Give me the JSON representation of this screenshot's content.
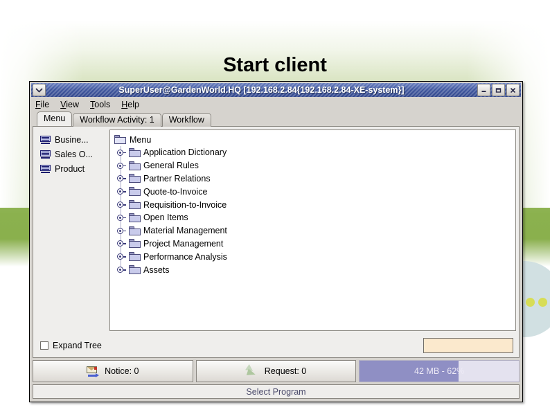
{
  "slide": {
    "title": "Start client"
  },
  "window": {
    "title": "SuperUser@GardenWorld.HQ [192.168.2.84{192.168.2.84-XE-system}]",
    "system_menu_icon": "chevron-down-icon",
    "controls": {
      "minimize": "–",
      "maximize": "❐",
      "close": "✖"
    }
  },
  "menubar": {
    "items": [
      {
        "label": "File",
        "mnemonic": "F",
        "rest": "ile"
      },
      {
        "label": "View",
        "mnemonic": "V",
        "rest": "iew"
      },
      {
        "label": "Tools",
        "mnemonic": "T",
        "rest": "ools"
      },
      {
        "label": "Help",
        "mnemonic": "H",
        "rest": "elp"
      }
    ]
  },
  "tabs": [
    {
      "label": "Menu",
      "active": true
    },
    {
      "label": "Workflow Activity: 1",
      "active": false
    },
    {
      "label": "Workflow",
      "active": false
    }
  ],
  "sidebar": {
    "items": [
      {
        "label": "Busine...",
        "icon": "screen-icon"
      },
      {
        "label": "Sales O...",
        "icon": "screen-icon"
      },
      {
        "label": "Product",
        "icon": "screen-icon"
      }
    ]
  },
  "tree": {
    "root": {
      "label": "Menu",
      "icon": "folder-icon"
    },
    "nodes": [
      {
        "label": "Application Dictionary",
        "icon": "folder-icon",
        "handle": "expand-handle"
      },
      {
        "label": "General Rules",
        "icon": "folder-icon",
        "handle": "expand-handle"
      },
      {
        "label": "Partner Relations",
        "icon": "folder-icon",
        "handle": "expand-handle"
      },
      {
        "label": "Quote-to-Invoice",
        "icon": "folder-icon",
        "handle": "expand-handle"
      },
      {
        "label": "Requisition-to-Invoice",
        "icon": "folder-icon",
        "handle": "expand-handle"
      },
      {
        "label": "Open Items",
        "icon": "folder-icon",
        "handle": "expand-handle"
      },
      {
        "label": "Material Management",
        "icon": "folder-icon",
        "handle": "expand-handle"
      },
      {
        "label": "Project Management",
        "icon": "folder-icon",
        "handle": "expand-handle"
      },
      {
        "label": "Performance Analysis",
        "icon": "folder-icon",
        "handle": "expand-handle"
      },
      {
        "label": "Assets",
        "icon": "folder-icon",
        "handle": "expand-handle"
      }
    ]
  },
  "footer": {
    "expand_tree_label": "Expand Tree",
    "expand_tree_checked": false,
    "search_value": "",
    "search_placeholder": ""
  },
  "statusbar": {
    "notice_label": "Notice: 0",
    "request_label": "Request: 0",
    "memory_label": "42 MB - 62%",
    "memory_percent": 62,
    "select_program_label": "Select Program"
  },
  "colors": {
    "slide_green": "#8bb14e",
    "titlebar_blue": "#41589f",
    "memory_fill": "#8f8fc4",
    "memory_track": "#e4e2ef",
    "search_field": "#fbe9cd",
    "folder": "#c9cbeb",
    "deco_dot": "#d7dd56",
    "deco_circle": "#cfdee0"
  }
}
